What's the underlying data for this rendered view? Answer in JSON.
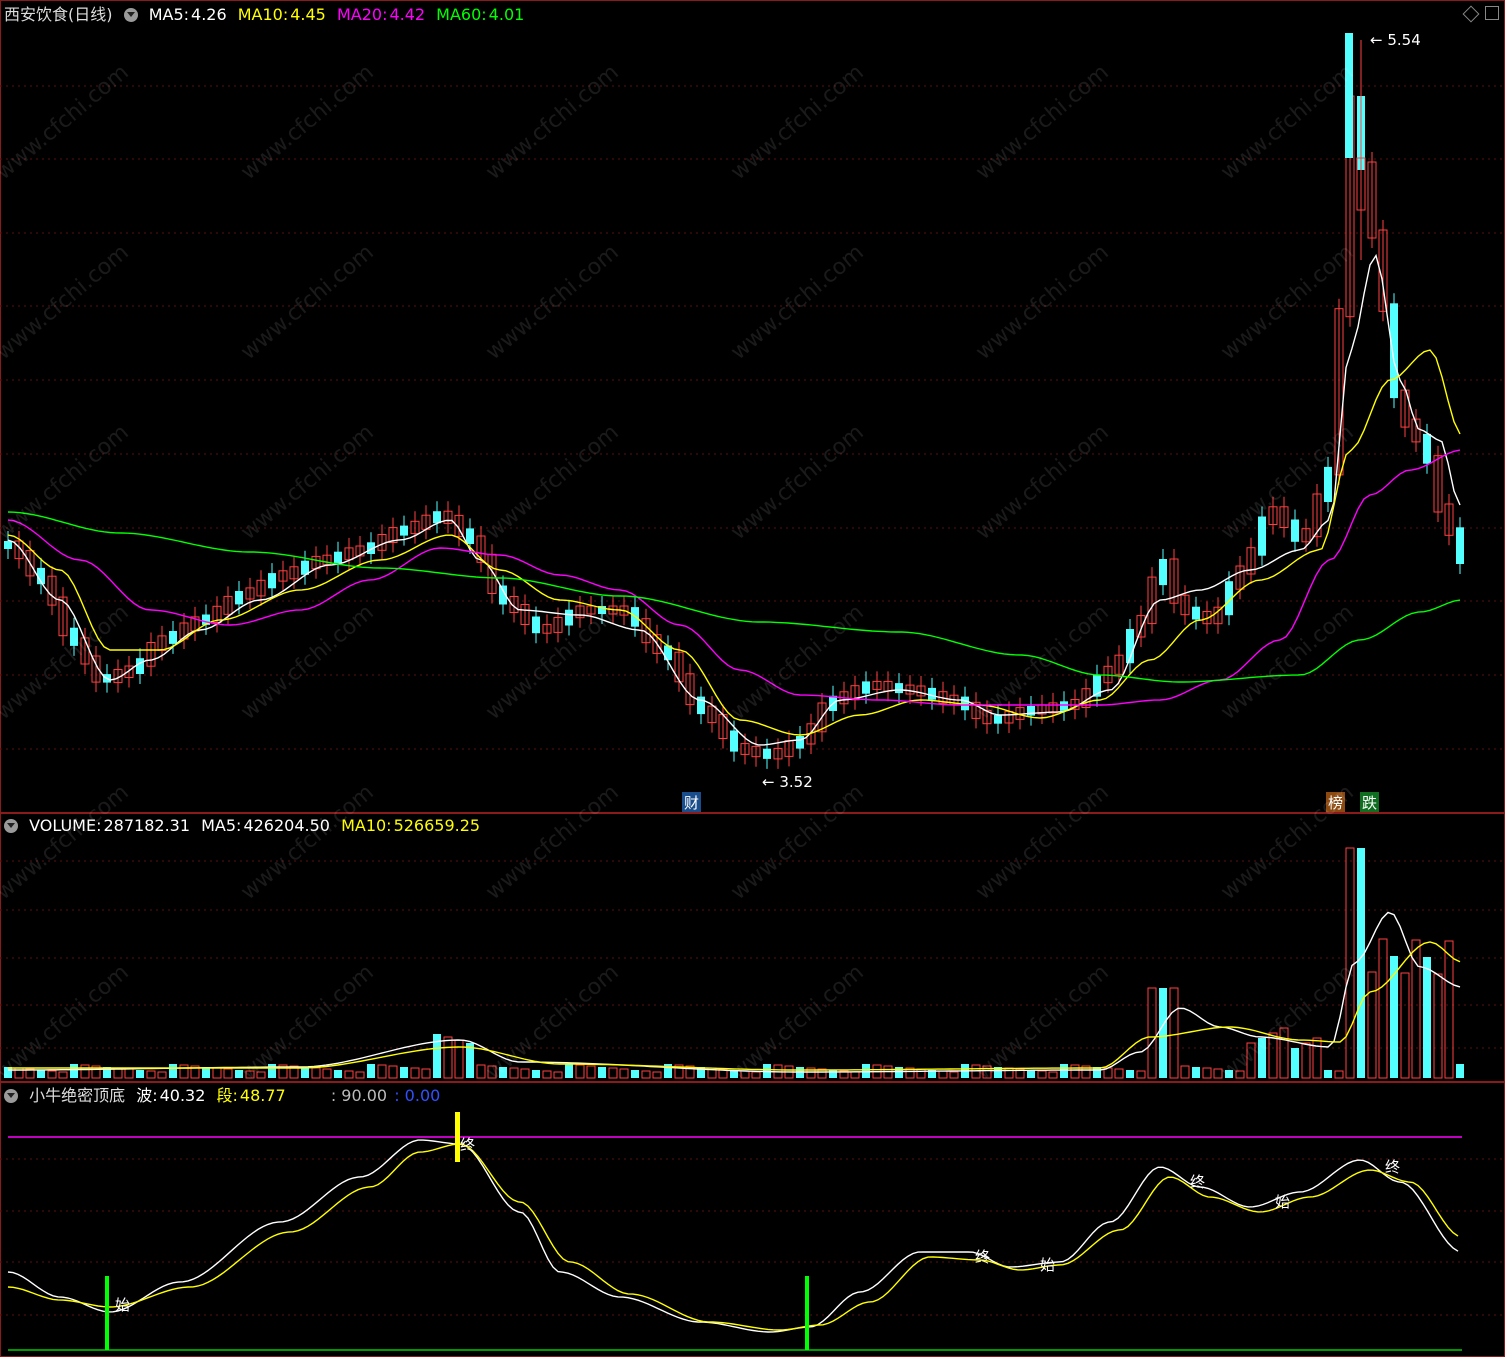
{
  "main": {
    "stock_name": "西安饮食(日线)",
    "ma5": {
      "label": "MA5:",
      "value": "4.26",
      "color": "#ffffff"
    },
    "ma10": {
      "label": "MA10:",
      "value": "4.45",
      "color": "#ffff00"
    },
    "ma20": {
      "label": "MA20:",
      "value": "4.42",
      "color": "#ff00ff"
    },
    "ma60": {
      "label": "MA60:",
      "value": "4.01",
      "color": "#00ff00"
    },
    "high_label": "5.54",
    "low_label": "3.52",
    "marker_cai": "财",
    "marker_bang": "榜",
    "marker_die": "跌"
  },
  "volume": {
    "label": "VOLUME:",
    "value": "287182.31",
    "ma5_label": "MA5:",
    "ma5_value": "426204.50",
    "ma10_label": "MA10:",
    "ma10_value": "526659.25"
  },
  "indicator": {
    "name": "小牛绝密顶底",
    "bo_label": "波:",
    "bo_value": "40.32",
    "duan_label": "段:",
    "duan_value": "48.77",
    "level_value": ": 90.00",
    "zero_value": ": 0.00",
    "markers": [
      "终",
      "始",
      "终",
      "始",
      "终",
      "始",
      "终"
    ]
  },
  "watermark": "www.cfchi.com",
  "colors": {
    "up": "#ff4040",
    "down": "#54ffff",
    "border": "#8b1a1a"
  }
}
